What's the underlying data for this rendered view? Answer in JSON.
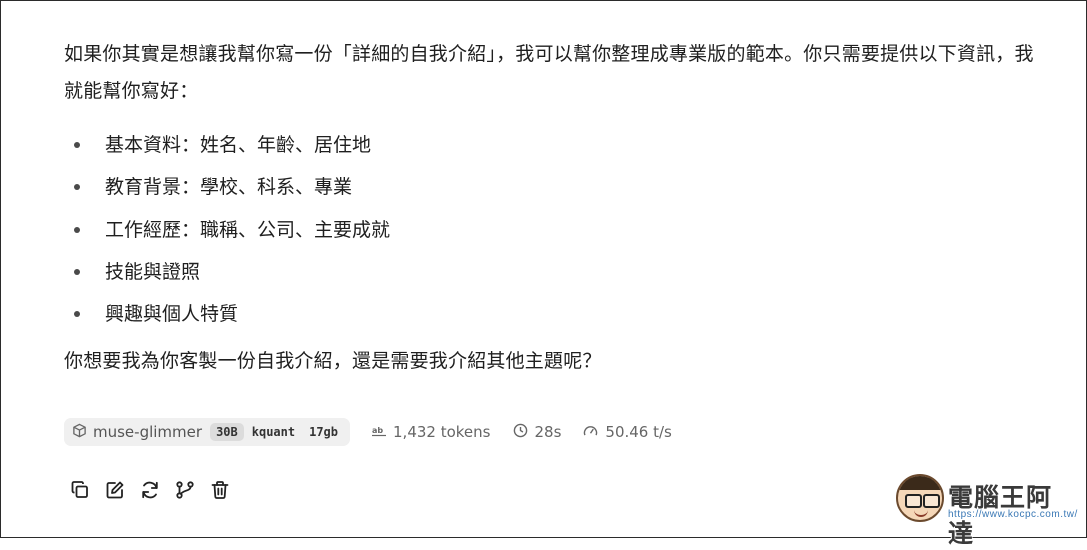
{
  "message": {
    "intro": "如果你其實是想讓我幫你寫一份「詳細的自我介紹」，我可以幫你整理成專業版的範本。你只需要提供以下資訊，我就能幫你寫好：",
    "items": [
      "基本資料：姓名、年齡、居住地",
      "教育背景：學校、科系、專業",
      "工作經歷：職稱、公司、主要成就",
      "技能與證照",
      "興趣與個人特質"
    ],
    "closing": "你想要我為你客製一份自我介紹，還是需要我介紹其他主題呢？"
  },
  "meta": {
    "model_icon": "cube-icon",
    "model_name": "muse-glimmer",
    "tags": [
      "30B",
      "kquant",
      "17gb"
    ],
    "tokens": "1,432 tokens",
    "duration": "28s",
    "speed": "50.46 t/s"
  },
  "actions": [
    {
      "name": "copy-button",
      "icon": "copy-icon"
    },
    {
      "name": "edit-button",
      "icon": "edit-icon"
    },
    {
      "name": "regenerate-button",
      "icon": "refresh-icon"
    },
    {
      "name": "branch-button",
      "icon": "branch-icon"
    },
    {
      "name": "delete-button",
      "icon": "trash-icon"
    }
  ],
  "watermark": {
    "title": "電腦王阿達",
    "url": "https://www.kocpc.com.tw/"
  },
  "colors": {
    "text": "#1f1f1f",
    "muted": "#666666",
    "chip_bg": "#f0f0f0",
    "watermark_url": "#3a78b5"
  }
}
